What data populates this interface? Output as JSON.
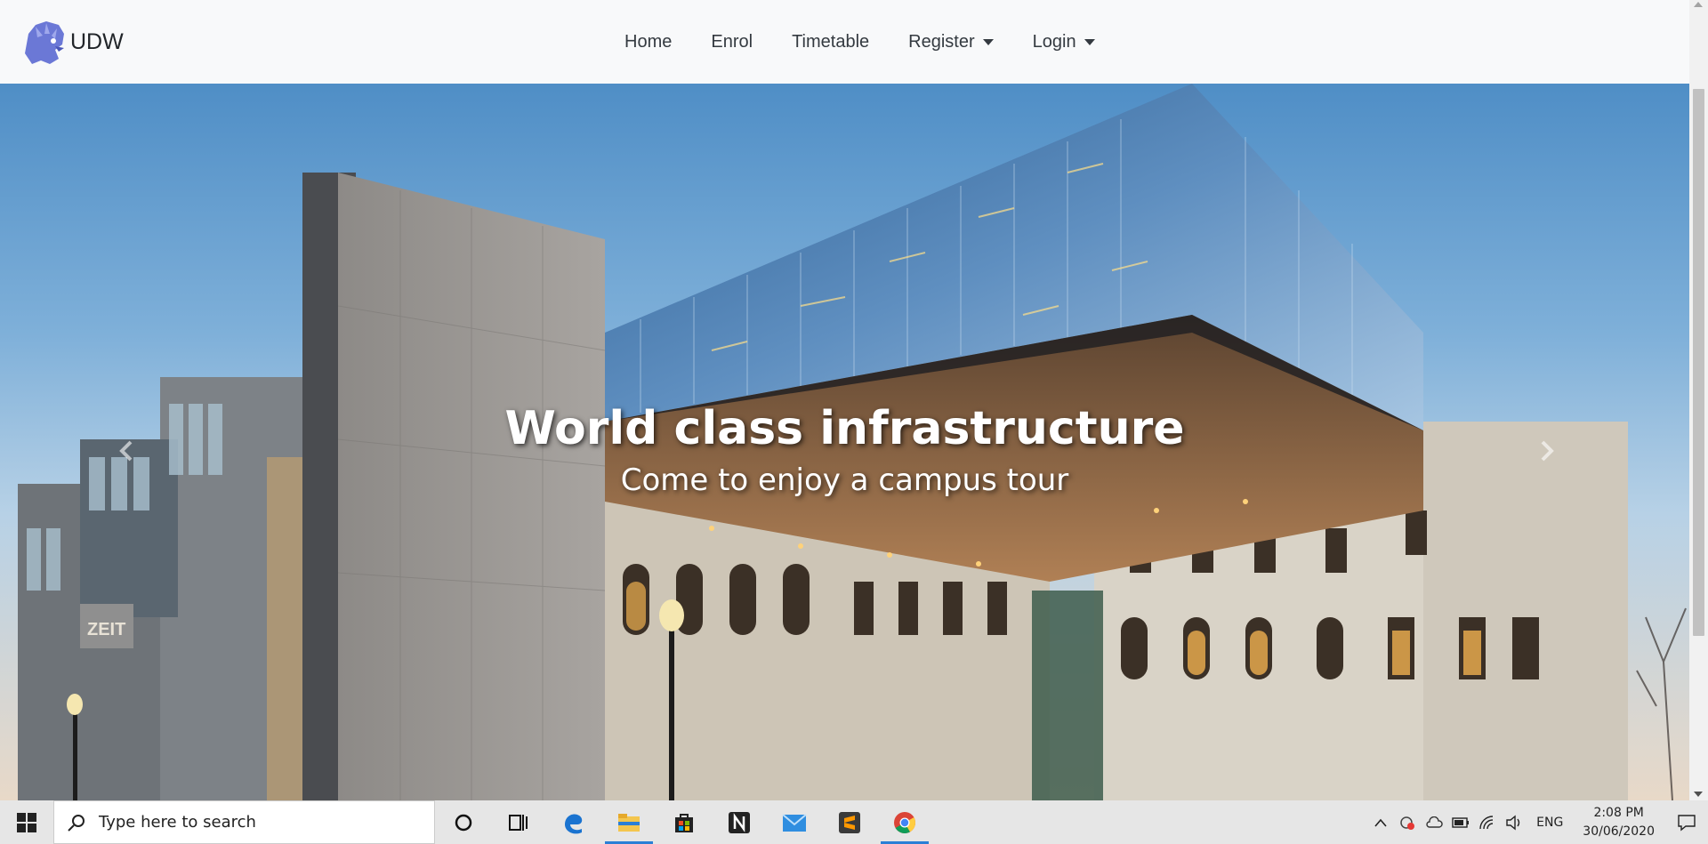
{
  "navbar": {
    "brand": "UDW",
    "links": [
      {
        "label": "Home",
        "dropdown": false
      },
      {
        "label": "Enrol",
        "dropdown": false
      },
      {
        "label": "Timetable",
        "dropdown": false
      },
      {
        "label": "Register",
        "dropdown": true
      },
      {
        "label": "Login",
        "dropdown": true
      }
    ]
  },
  "carousel": {
    "title": "World class infrastructure",
    "subtitle": "Come to enjoy a campus tour",
    "sign_text": "ZEIT"
  },
  "taskbar": {
    "search_placeholder": "Type here to search",
    "language": "ENG",
    "time": "2:08 PM",
    "date": "30/06/2020",
    "apps": [
      "cortana-icon",
      "task-view-icon",
      "edge-icon",
      "file-explorer-icon",
      "store-icon",
      "notion-icon",
      "mail-icon",
      "sublime-icon",
      "chrome-icon"
    ]
  },
  "colors": {
    "accent": "#2b7fd6",
    "navbar_bg": "#f8f9fa"
  }
}
